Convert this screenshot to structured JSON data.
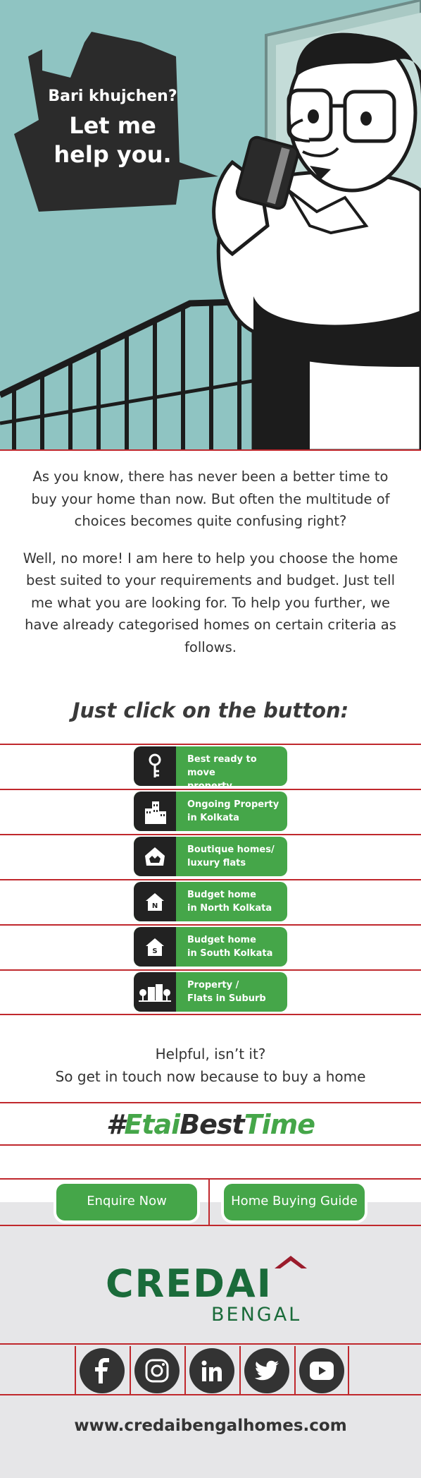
{
  "hero": {
    "bubble_line1": "Bari khujchen?",
    "bubble_line2": "Let me",
    "bubble_line3": "help you."
  },
  "intro": {
    "paragraph1": "As you know, there has never been a better time to buy your home than now. But often the multitude of choices becomes quite confusing right?",
    "paragraph2": "Well, no more! I am here to help you choose the home best suited to your requirements and budget. Just tell me what you are looking for. To help you further, we have already categorised homes on certain criteria as follows."
  },
  "cta_heading": "Just click on the button:",
  "categories": [
    {
      "label": "Best ready to move\nproperty",
      "icon": "key-icon"
    },
    {
      "label": "Ongoing Property\nin Kolkata",
      "icon": "buildings-icon"
    },
    {
      "label": "Boutique homes/\nluxury flats",
      "icon": "luxury-home-icon"
    },
    {
      "label": "Budget home\nin North Kolkata",
      "icon": "north-home-icon"
    },
    {
      "label": "Budget home\nin South Kolkata",
      "icon": "south-home-icon"
    },
    {
      "label": "Property /\nFlats in Suburb",
      "icon": "suburb-icon"
    }
  ],
  "helpful": {
    "line1": "Helpful, isn’t it?",
    "line2": "So get in touch now because to buy a home"
  },
  "hashtag": {
    "part1": "#",
    "part2": "Etai",
    "part3": "Best",
    "part4": "Time"
  },
  "actions": {
    "enquire": "Enquire Now",
    "guide": "Home Buying Guide"
  },
  "footer": {
    "logo_main": "CREDAI",
    "logo_sub": "BENGAL",
    "social": [
      "facebook-icon",
      "instagram-icon",
      "linkedin-icon",
      "twitter-icon",
      "youtube-icon"
    ],
    "url": "www.credaibengalhomes.com"
  },
  "colors": {
    "accent_green": "#45a649",
    "divider_red": "#c0282d",
    "hero_bg": "#8fc4c2",
    "brand_green": "#1a6b3a"
  }
}
